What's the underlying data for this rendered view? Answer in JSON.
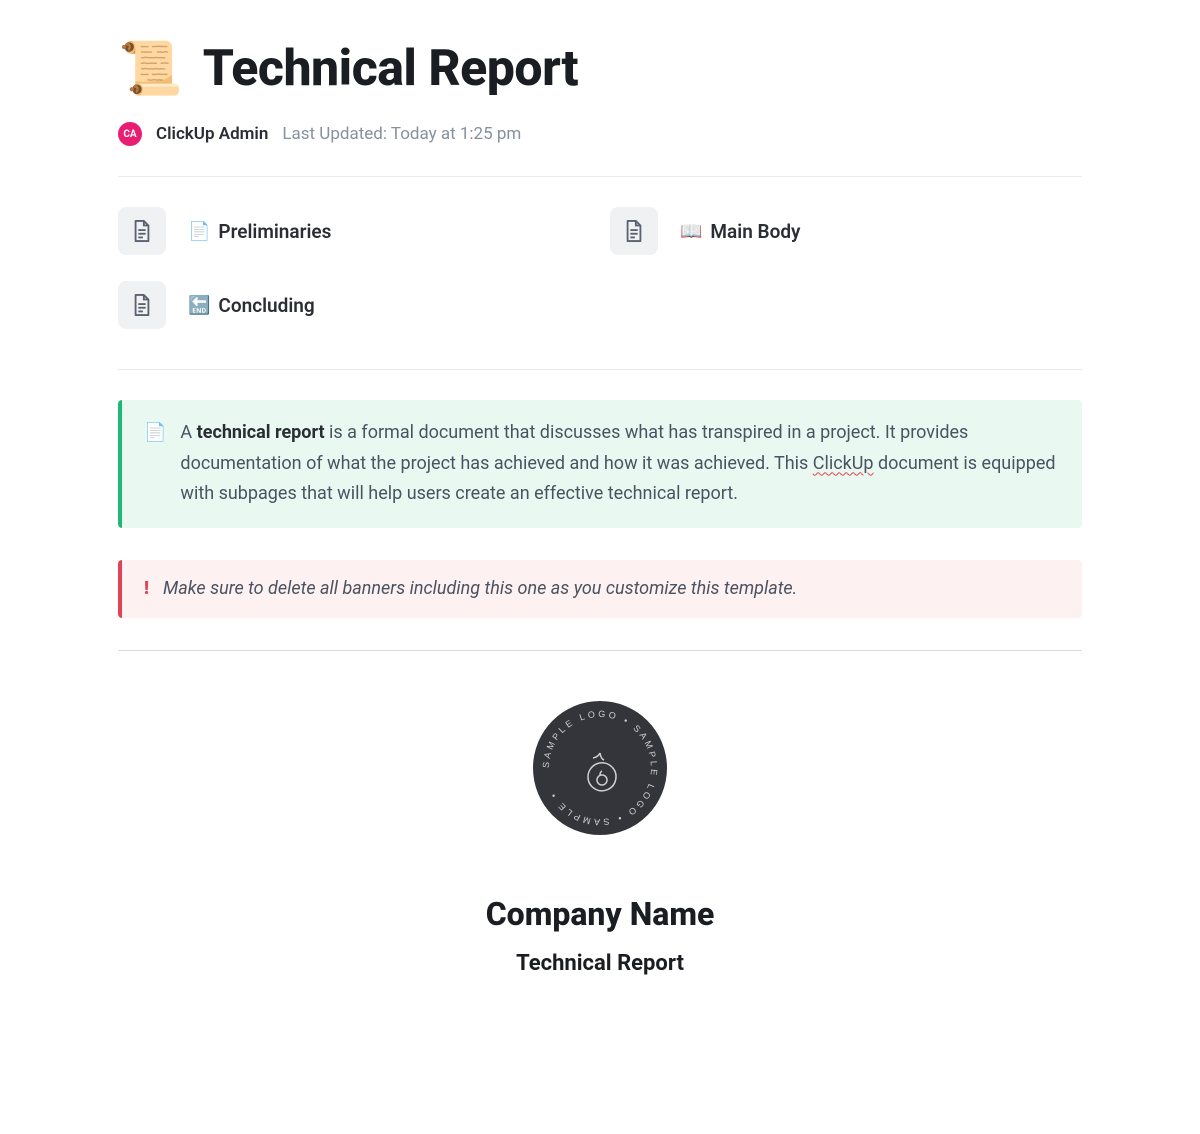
{
  "header": {
    "icon": "scroll-icon",
    "title": "Technical Report"
  },
  "meta": {
    "avatar_initials": "CA",
    "author": "ClickUp Admin",
    "last_updated_label": "Last Updated: Today at 1:25 pm"
  },
  "subpages": [
    {
      "icon": "📄",
      "label": "Preliminaries"
    },
    {
      "icon": "📖",
      "label": "Main Body"
    },
    {
      "icon": "🔚",
      "label": "Concluding"
    }
  ],
  "banner_info": {
    "prefix": "A ",
    "bold": "technical report",
    "text1": " is a formal document that discusses what has transpired in a project. It provides documentation of what the project has achieved and how it was achieved. This ",
    "link_word": "ClickUp",
    "text2": " document is equipped with subpages that will help users create an effective technical report."
  },
  "banner_warning": {
    "icon": "!",
    "text": "Make sure to delete all banners including this one as you customize this template."
  },
  "logo": {
    "circle_text": "SAMPLE LOGO • SAMPLE LOGO • SAMPLE • "
  },
  "company": {
    "name": "Company Name",
    "subtitle": "Technical Report"
  }
}
